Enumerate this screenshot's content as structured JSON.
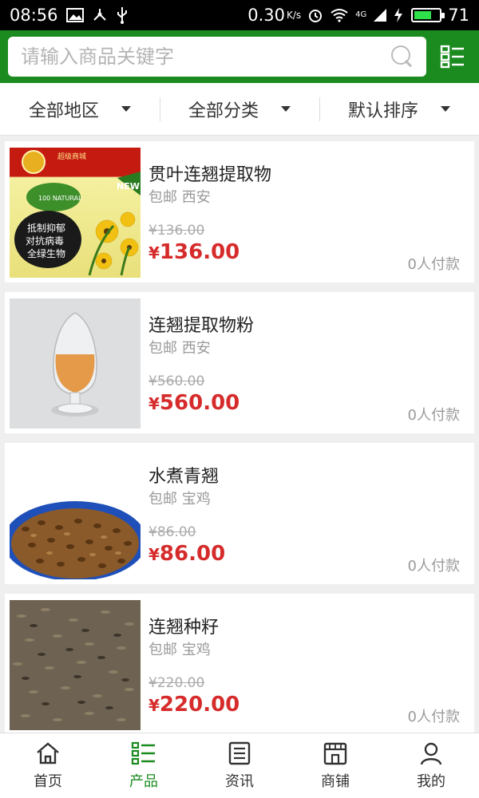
{
  "status_bar": {
    "time": "08:56",
    "speed": "0.30",
    "speed_unit": "K/s",
    "signal": "4G",
    "battery": "71",
    "battery_level": 0.71
  },
  "header": {
    "search_placeholder": "请输入商品关键字"
  },
  "filters": [
    {
      "label": "全部地区"
    },
    {
      "label": "全部分类"
    },
    {
      "label": "默认排序"
    }
  ],
  "products": [
    {
      "name": "贯叶连翘提取物",
      "shipping": "包邮 西安",
      "old_price": "¥136.00",
      "currency": "¥",
      "price": "136.00",
      "paid": "0人付款",
      "thumb_texts": {
        "top": "超级商城",
        "badge": "100 NATURAL",
        "new": "NEW",
        "lines": [
          "抵制抑郁",
          "对抗病毒",
          "全绿生物"
        ]
      }
    },
    {
      "name": "连翘提取物粉",
      "shipping": "包邮 西安",
      "old_price": "¥560.00",
      "currency": "¥",
      "price": "560.00",
      "paid": "0人付款"
    },
    {
      "name": "水煮青翘",
      "shipping": "包邮 宝鸡",
      "old_price": "¥86.00",
      "currency": "¥",
      "price": "86.00",
      "paid": "0人付款"
    },
    {
      "name": "连翘种籽",
      "shipping": "包邮 宝鸡",
      "old_price": "¥220.00",
      "currency": "¥",
      "price": "220.00",
      "paid": "0人付款"
    }
  ],
  "bottom_nav": [
    {
      "label": "首页",
      "icon": "home-icon",
      "active": false
    },
    {
      "label": "产品",
      "icon": "list-icon",
      "active": true
    },
    {
      "label": "资讯",
      "icon": "news-icon",
      "active": false
    },
    {
      "label": "商铺",
      "icon": "store-icon",
      "active": false
    },
    {
      "label": "我的",
      "icon": "user-icon",
      "active": false
    }
  ],
  "colors": {
    "brand_green": "#1b8a1f",
    "price_red": "#d62b2b"
  }
}
